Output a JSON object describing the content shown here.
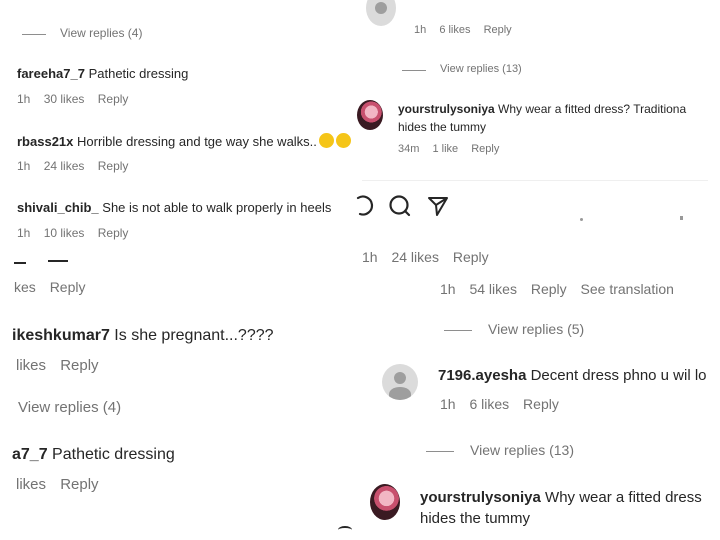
{
  "tl": {
    "view_replies_1": "View replies (4)",
    "c1": {
      "user": "fareeha7_7",
      "text": "Pathetic dressing",
      "time": "1h",
      "likes": "30 likes",
      "reply": "Reply"
    },
    "c2": {
      "user": "rbass21x",
      "text": "Horrible dressing and tge way she walks..",
      "time": "1h",
      "likes": "24 likes",
      "reply": "Reply"
    },
    "c3": {
      "user": "shivali_chib_",
      "text": "She is not able to walk properly in heels",
      "time": "1h",
      "likes": "10 likes",
      "reply": "Reply"
    }
  },
  "tr": {
    "top_meta": {
      "time": "1h",
      "likes": "6 likes",
      "reply": "Reply"
    },
    "view_replies": "View replies (13)",
    "c1": {
      "user": "yourstrulysoniya",
      "text": "Why wear a fitted dress? Traditiona",
      "text2": "hides the tummy",
      "time": "34m",
      "likes": "1 like",
      "reply": "Reply"
    },
    "icons": [
      "comment-icon",
      "share-icon"
    ]
  },
  "bl": {
    "partial_meta": {
      "likes": "kes",
      "reply": "Reply"
    },
    "c1": {
      "user": "ikeshkumar7",
      "text": "Is she pregnant...????",
      "likes": "likes",
      "reply": "Reply"
    },
    "view_replies": "View replies (4)",
    "c2": {
      "user": "a7_7",
      "text": "Pathetic dressing",
      "likes": "likes",
      "reply": "Reply"
    }
  },
  "br": {
    "top_meta": {
      "time": "1h",
      "likes": "24 likes",
      "reply": "Reply"
    },
    "meta2": {
      "time": "1h",
      "likes": "54 likes",
      "reply": "Reply",
      "translate": "See translation"
    },
    "view_replies_1": "View replies (5)",
    "c1": {
      "user": "7196.ayesha",
      "text": "Decent dress phno u wil lo",
      "time": "1h",
      "likes": "6 likes",
      "reply": "Reply"
    },
    "view_replies_2": "View replies (13)",
    "c2": {
      "user": "yourstrulysoniya",
      "text": "Why wear a fitted dress",
      "text2": "hides the tummy"
    }
  }
}
